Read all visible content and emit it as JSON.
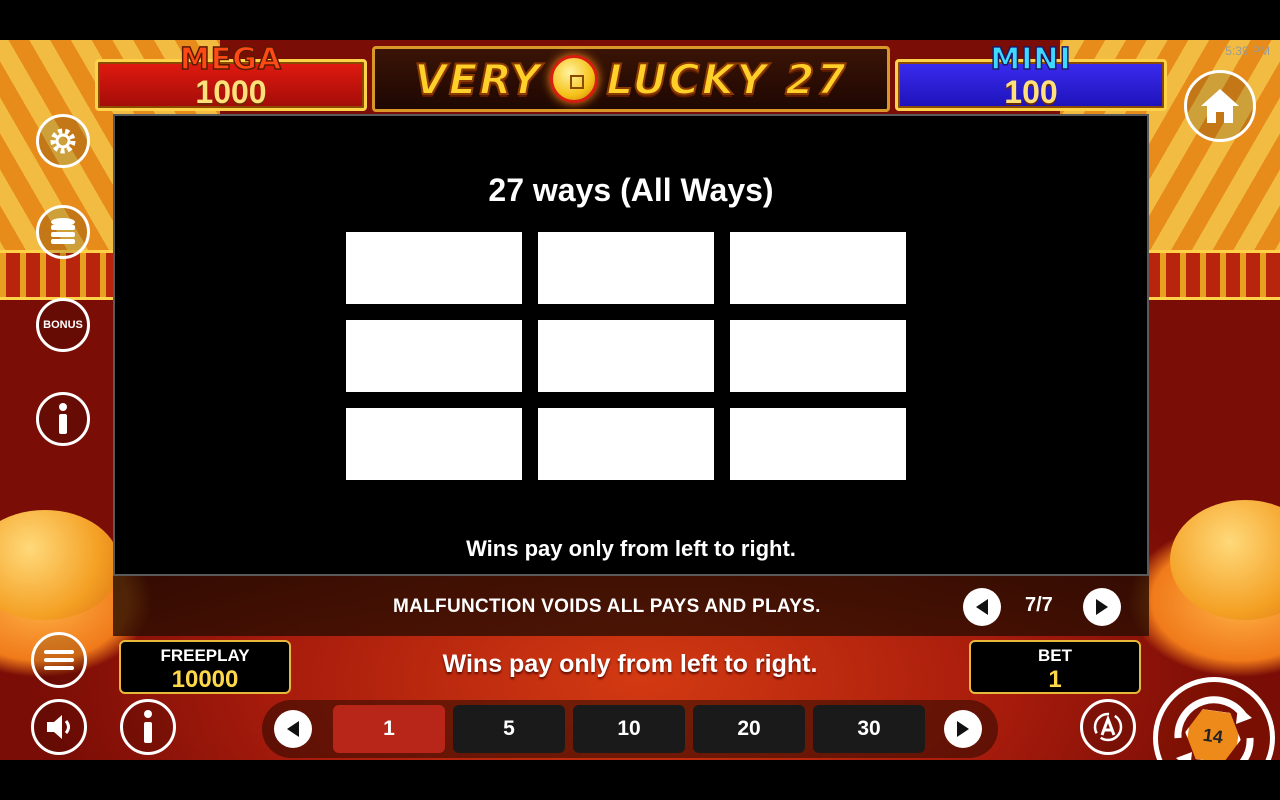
{
  "status_bar": {
    "clock": "5:39 PM"
  },
  "jackpots": {
    "mega": {
      "label": "MEGA",
      "value": "1000"
    },
    "mini": {
      "label": "MINI",
      "value": "100"
    }
  },
  "game_title": {
    "word1": "VERY",
    "word2": "LUCKY 27"
  },
  "left_buttons": {
    "bonus_label": "BONUS"
  },
  "paytable": {
    "title": "27 ways (All Ways)",
    "footer": "Wins pay only from left to right.",
    "grid_rows": 3,
    "grid_cols": 3
  },
  "pager": {
    "disclaimer": "MALFUNCTION VOIDS ALL PAYS AND PLAYS.",
    "page_indicator": "7/7"
  },
  "credits": {
    "label": "FREEPLAY",
    "value": "10000"
  },
  "bet": {
    "label": "BET",
    "value": "1"
  },
  "message": "Wins pay only from left to right.",
  "bet_options": [
    "1",
    "5",
    "10",
    "20",
    "30"
  ],
  "selected_bet_index": 0,
  "spin": {
    "badge_text": "14"
  },
  "colors": {
    "mega": "#e21a10",
    "mini": "#3b2cf0",
    "accent_gold": "#ffd24a",
    "selected_bet": "#b8261a"
  }
}
